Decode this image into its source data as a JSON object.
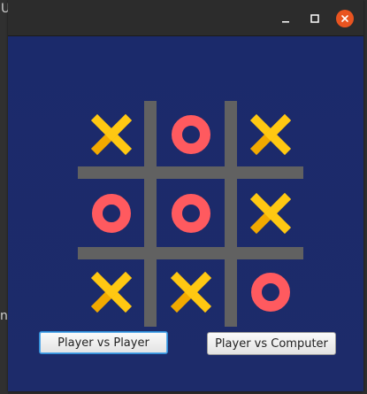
{
  "window": {
    "controls": [
      {
        "name": "minimize",
        "icon": "minimize-icon"
      },
      {
        "name": "maximize",
        "icon": "maximize-icon"
      },
      {
        "name": "close",
        "icon": "close-icon",
        "color": "#e95420"
      }
    ]
  },
  "background_fragments": [
    "U",
    "n"
  ],
  "board": {
    "cells": [
      [
        "X",
        "O",
        "X"
      ],
      [
        "O",
        "O",
        "X"
      ],
      [
        "X",
        "X",
        "O"
      ]
    ],
    "colors": {
      "x_color": "#ffc812",
      "x_shade": "#f2a900",
      "o_color": "#ff5a5f",
      "grid_color": "#616161",
      "background": "#1c2a68"
    }
  },
  "buttons": {
    "player_vs_player": "Player vs Player",
    "player_vs_computer": "Player vs Computer"
  }
}
